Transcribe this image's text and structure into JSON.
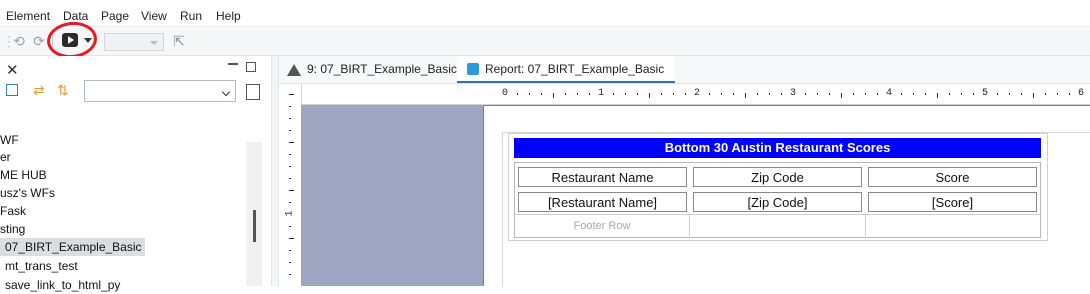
{
  "menu": [
    "Element",
    "Data",
    "Page",
    "View",
    "Run",
    "Help"
  ],
  "tree": {
    "items": [
      "WF",
      "er",
      "ME HUB",
      "usz's WFs",
      "Fask",
      "sting",
      "07_BIRT_Example_Basic",
      "mt_trans_test",
      "save_link_to_html_py"
    ],
    "selected_index": 6
  },
  "tabs": [
    {
      "label": "9: 07_BIRT_Example_Basic",
      "active": false
    },
    {
      "label": "Report: 07_BIRT_Example_Basic",
      "active": true
    }
  ],
  "ruler": {
    "h_labels": [
      "0",
      "1",
      "2",
      "3",
      "4",
      "5",
      "6"
    ],
    "v_labels": [
      "1"
    ]
  },
  "report": {
    "title": "Bottom 30 Austin Restaurant Scores",
    "title_color": "#0000ff",
    "headers": [
      "Restaurant Name",
      "Zip Code",
      "Score"
    ],
    "detail": [
      "[Restaurant Name]",
      "[Zip Code]",
      "[Score]"
    ],
    "footer_label": "Footer Row"
  },
  "colors": {
    "annotation": "#e8191f",
    "canvas_bg": "#9fa6c2"
  }
}
